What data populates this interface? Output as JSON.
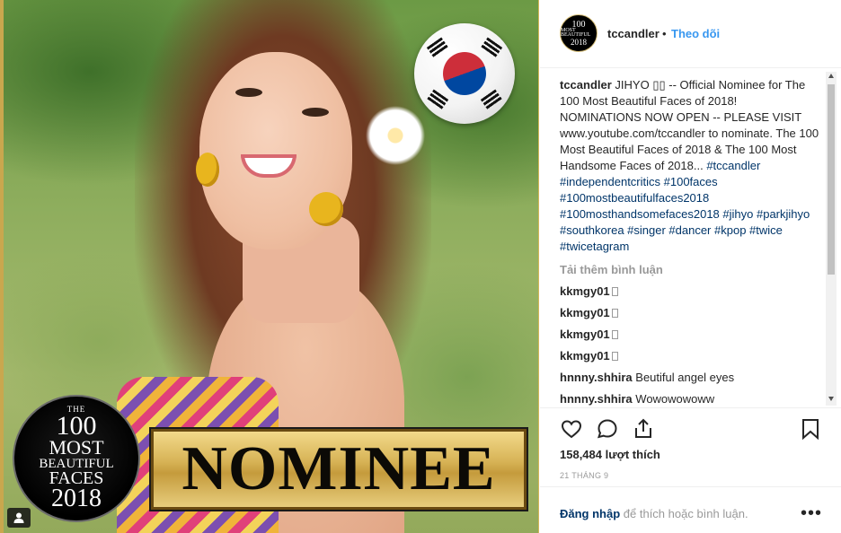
{
  "media": {
    "badge": {
      "the": "THE",
      "number": "100",
      "most": "MOST",
      "beautiful": "BEAUTIFUL",
      "faces": "FACES",
      "year": "2018"
    },
    "nominee_text": "NOMINEE",
    "flag_country": "South Korea"
  },
  "header": {
    "avatar": {
      "line1": "100",
      "line2": "MOST BEAUTIFUL",
      "line3": "2018"
    },
    "username": "tccandler",
    "separator": "•",
    "follow_label": "Theo dõi"
  },
  "caption": {
    "username": "tccandler",
    "text": " JIHYO ▯▯ -- Official Nominee for The 100 Most Beautiful Faces of 2018! NOMINATIONS NOW OPEN -- PLEASE VISIT www.youtube.com/tccandler to nominate. The 100 Most Beautiful Faces of 2018 & The 100 Most Handsome Faces of 2018... ",
    "hashtags": "#tccandler #independentcritics #100faces #100mostbeautifulfaces2018 #100mosthandsomefaces2018 #jihyo #parkjihyo #southkorea #singer #dancer #kpop #twice #twicetagram"
  },
  "load_more_label": "Tải thêm bình luận",
  "comments": [
    {
      "user": "kkmgy01",
      "text": ""
    },
    {
      "user": "kkmgy01",
      "text": ""
    },
    {
      "user": "kkmgy01",
      "text": ""
    },
    {
      "user": "kkmgy01",
      "text": ""
    },
    {
      "user": "hnnny.shhira",
      "text": "Beutiful angel eyes"
    },
    {
      "user": "hnnny.shhira",
      "text": "Wowowowoww"
    }
  ],
  "actions": {
    "likes": "158,484 lượt thích",
    "date": "21 THÁNG 9"
  },
  "login": {
    "link": "Đăng nhập",
    "rest": " để thích hoặc bình luận.",
    "more": "•••"
  },
  "colors": {
    "link_blue": "#3897f0",
    "hashtag": "#003569",
    "muted": "#999999",
    "gold": "#d7b356"
  },
  "icons": [
    "heart-icon",
    "comment-icon",
    "share-icon",
    "bookmark-icon",
    "user-tag-icon"
  ]
}
